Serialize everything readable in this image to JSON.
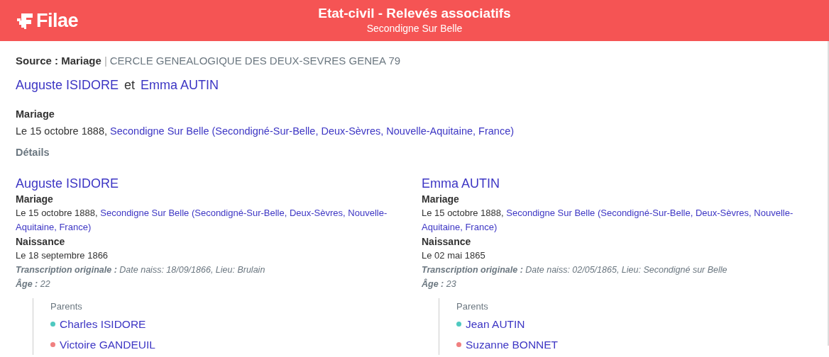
{
  "header": {
    "logo_text": "Filae",
    "title": "Etat-civil - Relevés associatifs",
    "subtitle": "Secondigne Sur Belle"
  },
  "source": {
    "label": "Source : Mariage",
    "separator": "|",
    "organisation": "CERCLE GENEALOGIQUE DES DEUX-SEVRES GENEA 79"
  },
  "couple": {
    "person_1": "Auguste ISIDORE",
    "conjunction": "et",
    "person_2": "Emma AUTIN"
  },
  "event": {
    "label": "Mariage",
    "date": "Le 15 octobre 1888,",
    "place": "Secondigne Sur Belle (Secondigné-Sur-Belle, Deux-Sèvres, Nouvelle-Aquitaine, France)"
  },
  "details_heading": "Détails",
  "persons": [
    {
      "name": "Auguste ISIDORE",
      "marriage_label": "Mariage",
      "marriage_date": "Le 15 octobre 1888,",
      "marriage_place": "Secondigne Sur Belle (Secondigné-Sur-Belle, Deux-Sèvres, Nouvelle-Aquitaine, France)",
      "birth_label": "Naissance",
      "birth_date": "Le 18 septembre 1866",
      "transcription": "**Transcription originale :** Date naiss: 18/09/1866, Lieu: Brulain",
      "age": "**Âge :** 22",
      "parents_label": "Parents",
      "parents": [
        {
          "name": "Charles ISIDORE",
          "color": "#4fc9c0"
        },
        {
          "name": "Victoire GANDEUIL",
          "color": "#f08080"
        }
      ]
    },
    {
      "name": "Emma AUTIN",
      "marriage_label": "Mariage",
      "marriage_date": "Le 15 octobre 1888,",
      "marriage_place": "Secondigne Sur Belle (Secondigné-Sur-Belle, Deux-Sèvres, Nouvelle-Aquitaine, France)",
      "birth_label": "Naissance",
      "birth_date": "Le 02 mai 1865",
      "transcription": "**Transcription originale :** Date naiss: 02/05/1865, Lieu: Secondigné sur Belle",
      "age": "**Âge :** 23",
      "parents_label": "Parents",
      "parents": [
        {
          "name": "Jean AUTIN",
          "color": "#4fc9c0"
        },
        {
          "name": "Suzanne BONNET",
          "color": "#f08080"
        }
      ]
    }
  ]
}
